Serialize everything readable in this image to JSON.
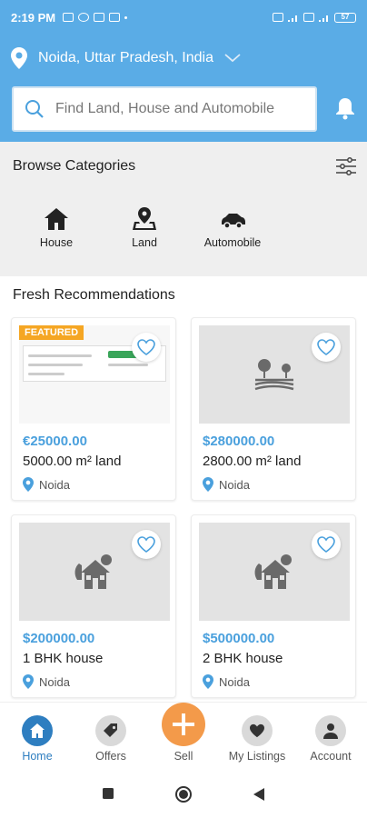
{
  "status_bar": {
    "time": "2:19 PM",
    "battery": "57"
  },
  "header": {
    "location": "Noida, Uttar Pradesh, India",
    "search_placeholder": "Find Land, House and Automobile"
  },
  "categories": {
    "title": "Browse Categories",
    "items": [
      {
        "label": "House",
        "icon": "house-icon"
      },
      {
        "label": "Land",
        "icon": "land-map-icon"
      },
      {
        "label": "Automobile",
        "icon": "car-icon"
      }
    ]
  },
  "recommendations": {
    "title": "Fresh Recommendations",
    "featured_badge": "FEATURED",
    "listings": [
      {
        "price": "€25000.00",
        "title": "5000.00 m² land",
        "location": "Noida",
        "featured": true
      },
      {
        "price": "$280000.00",
        "title": "2800.00 m² land",
        "location": "Noida",
        "featured": false
      },
      {
        "price": "$200000.00",
        "title": "1 BHK house",
        "location": "Noida",
        "featured": false
      },
      {
        "price": "$500000.00",
        "title": "2 BHK house",
        "location": "Noida",
        "featured": false
      }
    ]
  },
  "bottom_nav": {
    "home": "Home",
    "offers": "Offers",
    "sell": "Sell",
    "my_listings": "My Listings",
    "account": "Account"
  },
  "colors": {
    "primary": "#5aace6",
    "price": "#4aa0dd",
    "active_nav": "#2e7ec0",
    "sell_fab": "#f39a4a",
    "featured": "#f5a623"
  }
}
